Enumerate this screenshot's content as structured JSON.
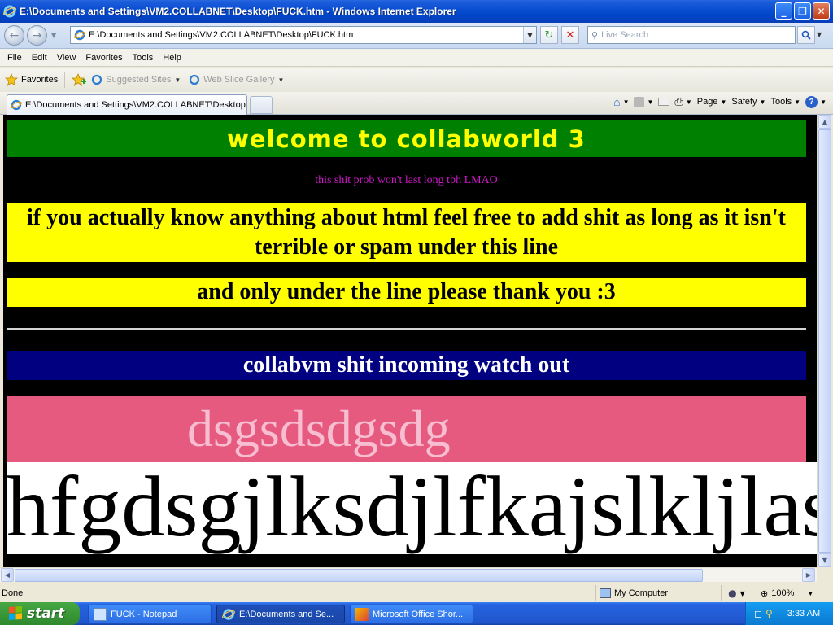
{
  "window": {
    "title": "E:\\Documents and Settings\\VM2.COLLABNET\\Desktop\\FUCK.htm - Windows Internet Explorer",
    "minimize": "_",
    "restore": "❐",
    "close": "✕"
  },
  "address_bar": {
    "url": "E:\\Documents and Settings\\VM2.COLLABNET\\Desktop\\FUCK.htm"
  },
  "search": {
    "placeholder": "Live Search"
  },
  "menu": {
    "items": [
      "File",
      "Edit",
      "View",
      "Favorites",
      "Tools",
      "Help"
    ]
  },
  "favorites_bar": {
    "favorites_label": "Favorites",
    "links": [
      "Suggested Sites",
      "Web Slice Gallery"
    ]
  },
  "tabs": {
    "active_label": "E:\\Documents and Settings\\VM2.COLLABNET\\Desktop..."
  },
  "command_bar": {
    "page": "Page",
    "safety": "Safety",
    "tools": "Tools"
  },
  "page": {
    "heading": "welcome to collabworld 3",
    "note": "this shit prob won't last long tbh LMAO",
    "instruction": "if you actually know anything about html feel free to add shit as long as it isn't terrible or spam under this line",
    "instruction2": "and only under the line please thank you :3",
    "collabvm": "collabvm shit incoming watch out",
    "pink_text": "dsgsdsdgsdg",
    "big_text": "hfgdsgjlksdjlfkajslkljlasj"
  },
  "status_bar": {
    "status": "Done",
    "zone": "My Computer",
    "zoom": "100%"
  },
  "taskbar": {
    "start": "start",
    "tasks": [
      "FUCK - Notepad",
      "E:\\Documents and Se...",
      "Microsoft Office Shor..."
    ],
    "clock": "3:33 AM"
  },
  "colors": {
    "green_bar": "#008000",
    "yellow_text": "#ffff00",
    "magenta_note": "#d018c8",
    "yellow_bar": "#ffff00",
    "navy_bar": "#000080",
    "pink_bar": "#e75a80",
    "pink_text": "#f7bdd0"
  }
}
